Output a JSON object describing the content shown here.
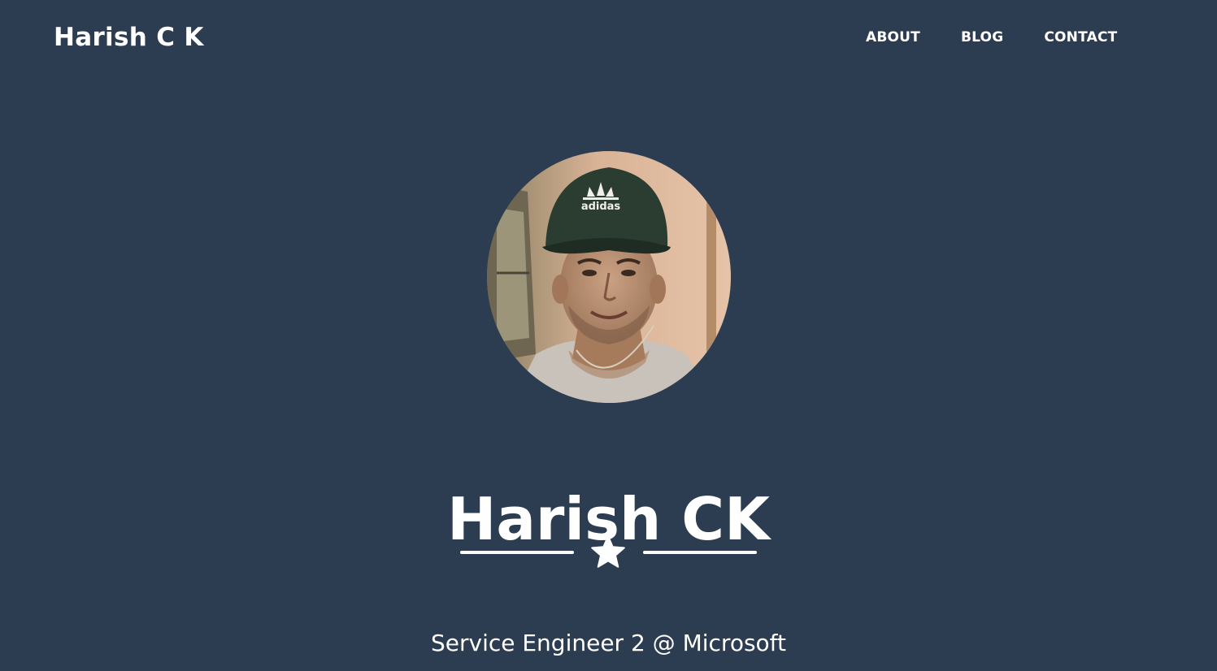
{
  "navbar": {
    "brand": "Harish C K",
    "links": [
      {
        "label": "ABOUT"
      },
      {
        "label": "BLOG"
      },
      {
        "label": "CONTACT"
      }
    ]
  },
  "hero": {
    "avatar_icon": "profile-photo",
    "title": "Harish CK",
    "divider_icon": "star-icon",
    "subtitle": "Service Engineer 2 @ Microsoft"
  },
  "colors": {
    "background": "#2d3d51",
    "text": "#ffffff"
  }
}
